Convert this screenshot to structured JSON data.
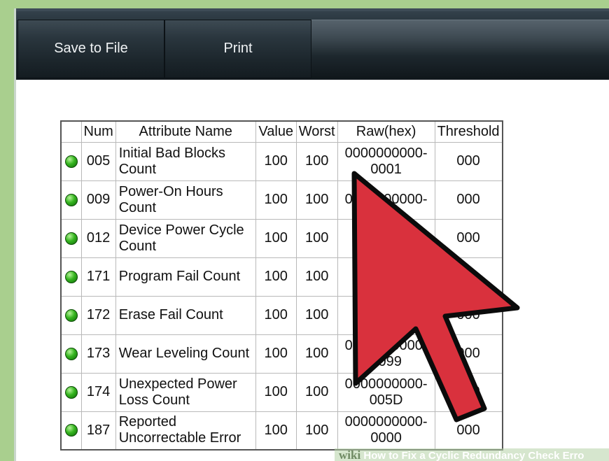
{
  "toolbar": {
    "save_label": "Save to File",
    "print_label": "Print"
  },
  "table": {
    "headers": [
      "",
      "Num",
      "Attribute Name",
      "Value",
      "Worst",
      "Raw(hex)",
      "Threshold"
    ],
    "rows": [
      {
        "num": "005",
        "name": "Initial Bad Blocks Count",
        "value": "100",
        "worst": "100",
        "raw": "0000000000-0001",
        "threshold": "000"
      },
      {
        "num": "009",
        "name": "Power-On Hours Count",
        "value": "100",
        "worst": "100",
        "raw": "0000000000-",
        "threshold": "000"
      },
      {
        "num": "012",
        "name": "Device Power Cycle Count",
        "value": "100",
        "worst": "100",
        "raw": "",
        "threshold": "000"
      },
      {
        "num": "171",
        "name": "Program Fail Count",
        "value": "100",
        "worst": "100",
        "raw": "",
        "threshold": ""
      },
      {
        "num": "172",
        "name": "Erase Fail Count",
        "value": "100",
        "worst": "100",
        "raw": "",
        "threshold": "000"
      },
      {
        "num": "173",
        "name": "Wear Leveling Count",
        "value": "100",
        "worst": "100",
        "raw": "0000000000-0099",
        "threshold": "000"
      },
      {
        "num": "174",
        "name": "Unexpected Power Loss Count",
        "value": "100",
        "worst": "100",
        "raw": "0000000000-005D",
        "threshold": "000"
      },
      {
        "num": "187",
        "name": "Reported Uncorrectable Error",
        "value": "100",
        "worst": "100",
        "raw": "0000000000-0000",
        "threshold": "000"
      }
    ]
  },
  "status_icon": "green-status-dot",
  "arrow_color": "#d9313d",
  "watermark": {
    "brand": "wiki",
    "text": "How to Fix a Cyclic Redundancy Check Erro"
  }
}
